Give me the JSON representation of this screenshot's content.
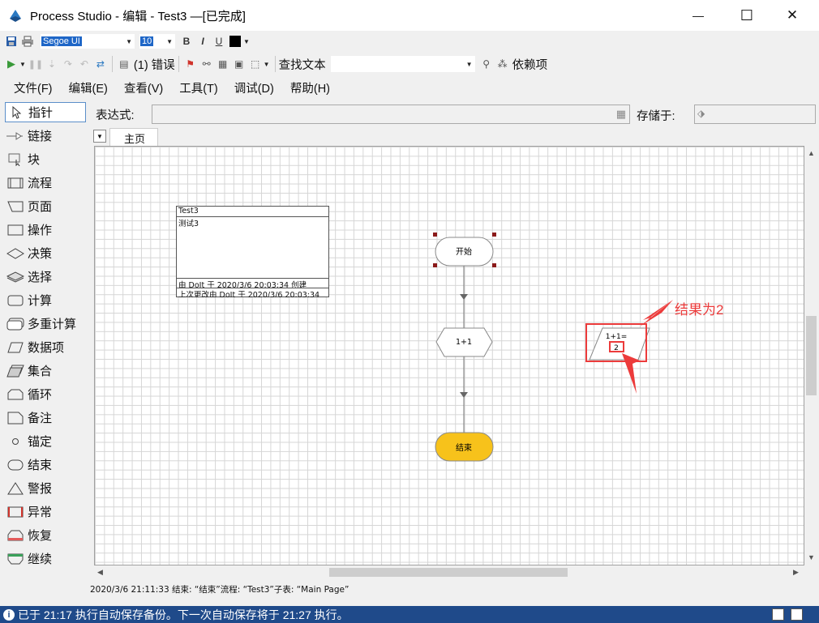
{
  "window": {
    "title": "Process Studio  - 编辑 - Test3 —[已完成]",
    "minimize_glyph": "—",
    "maximize_glyph": "☐",
    "close_glyph": "✕"
  },
  "format_toolbar": {
    "font_name": "Segoe UI",
    "font_size": "10",
    "bold": "B",
    "italic": "I",
    "underline": "U"
  },
  "main_toolbar": {
    "errors_label": "(1) 错误",
    "find_text_label": "查找文本",
    "dependencies_label": "依赖项"
  },
  "menu": {
    "items": [
      "文件(F)",
      "编辑(E)",
      "查看(V)",
      "工具(T)",
      "调试(D)",
      "帮助(H)"
    ]
  },
  "tools": {
    "items": [
      "指针",
      "链接",
      "块",
      "流程",
      "页面",
      "操作",
      "决策",
      "选择",
      "计算",
      "多重计算",
      "数据项",
      "集合",
      "循环",
      "备注",
      "锚定",
      "结束",
      "警报",
      "异常",
      "恢复",
      "继续"
    ]
  },
  "expression": {
    "label": "表达式:",
    "value": "",
    "store_label": "存储于:",
    "store_value": ""
  },
  "tabs": {
    "items": [
      "主页"
    ]
  },
  "diagram": {
    "note": {
      "title": "Test3",
      "body": "测试3",
      "created": "由 DoIt 于 2020/3/6 20:03:34 创建",
      "modified": "上次更改由 DoIt 于 2020/3/6 20:03:34"
    },
    "start_label": "开始",
    "calc_label": "1+1",
    "end_label": "结束",
    "data_item_label": "1+1=",
    "data_item_value": "2",
    "annotation": "结果为2",
    "colors": {
      "end_fill": "#f7c21b",
      "annotation": "#ec3b3b",
      "selection_handle": "#8b1a1a"
    }
  },
  "status": {
    "log": "2020/3/6 21:11:33 结束:  “结束”流程:  “Test3”子表:  “Main Page”",
    "autosave": "已于 21:17 执行自动保存备份。下一次自动保存将于 21:27 执行。"
  }
}
